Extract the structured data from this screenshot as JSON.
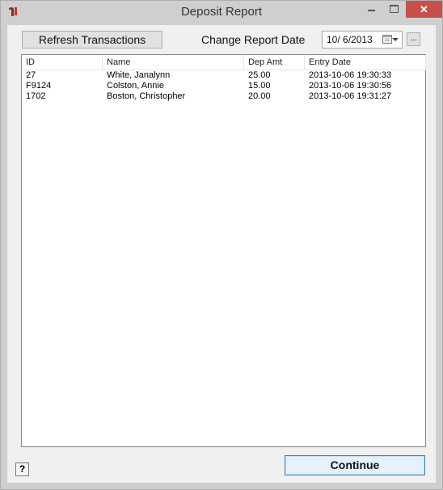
{
  "window": {
    "title": "Deposit Report",
    "close_symbol": "✕"
  },
  "toolbar": {
    "refresh_label": "Refresh Transactions",
    "date_label": "Change Report Date",
    "date_value": "10/  6/2013",
    "ellipsis_label": "..."
  },
  "table": {
    "columns": [
      "ID",
      "Name",
      "Dep Amt",
      "Entry Date"
    ],
    "rows": [
      [
        "27",
        "White, Janalynn",
        "25.00",
        "2013-10-06 19:30:33"
      ],
      [
        "F9124",
        "Colston, Annie",
        "15.00",
        "2013-10-06 19:30:56"
      ],
      [
        "1702",
        "Boston, Christopher",
        "20.00",
        "2013-10-06 19:31:27"
      ]
    ]
  },
  "footer": {
    "help_label": "?",
    "continue_label": "Continue"
  },
  "icons": {
    "app": "app-icon",
    "minimize": "minimize-icon",
    "maximize": "maximize-icon",
    "close": "close-icon",
    "calendar": "calendar-icon",
    "dropdown": "chevron-down-icon"
  },
  "colors": {
    "close_button": "#c7504a",
    "default_button_border": "#3c7fb1"
  }
}
